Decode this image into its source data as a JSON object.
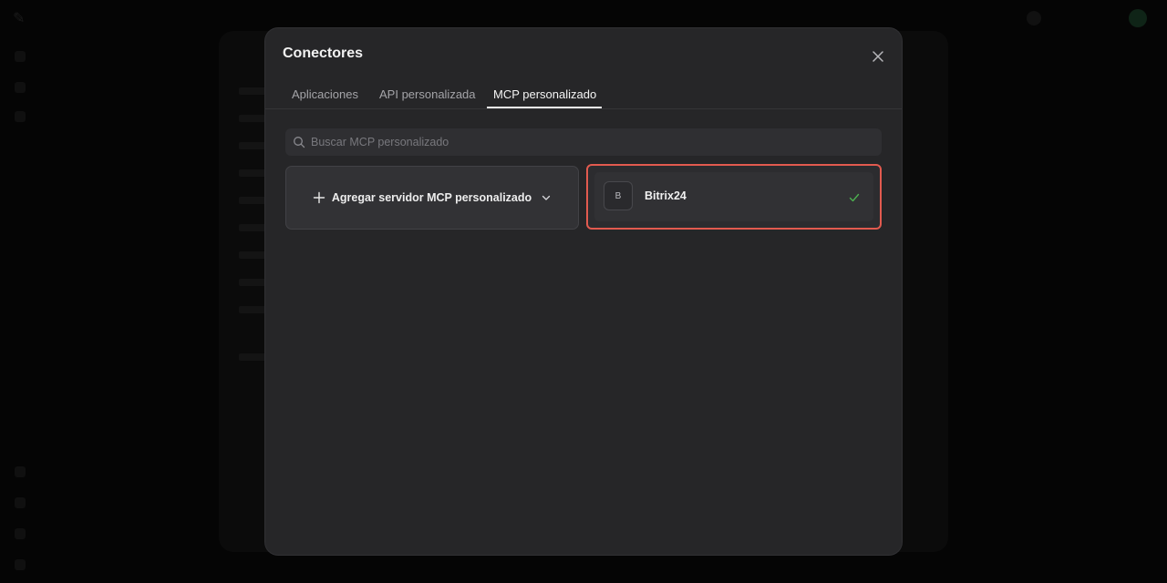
{
  "modal": {
    "title": "Conectores",
    "tabs": [
      {
        "label": "Aplicaciones",
        "active": false
      },
      {
        "label": "API personalizada",
        "active": false
      },
      {
        "label": "MCP personalizado",
        "active": true
      }
    ],
    "search": {
      "placeholder": "Buscar MCP personalizado",
      "value": ""
    },
    "add_server": {
      "label": "Agregar servidor MCP personalizado"
    },
    "servers": [
      {
        "name": "Bitrix24",
        "initial": "B",
        "connected": true
      }
    ]
  },
  "colors": {
    "modal_bg": "#262628",
    "highlight": "#e25a4f",
    "check": "#4caf50",
    "active_tab": "#f0f0f0"
  },
  "icons": [
    "close-icon",
    "search-icon",
    "plus-icon",
    "chevron-down-icon",
    "check-icon"
  ]
}
